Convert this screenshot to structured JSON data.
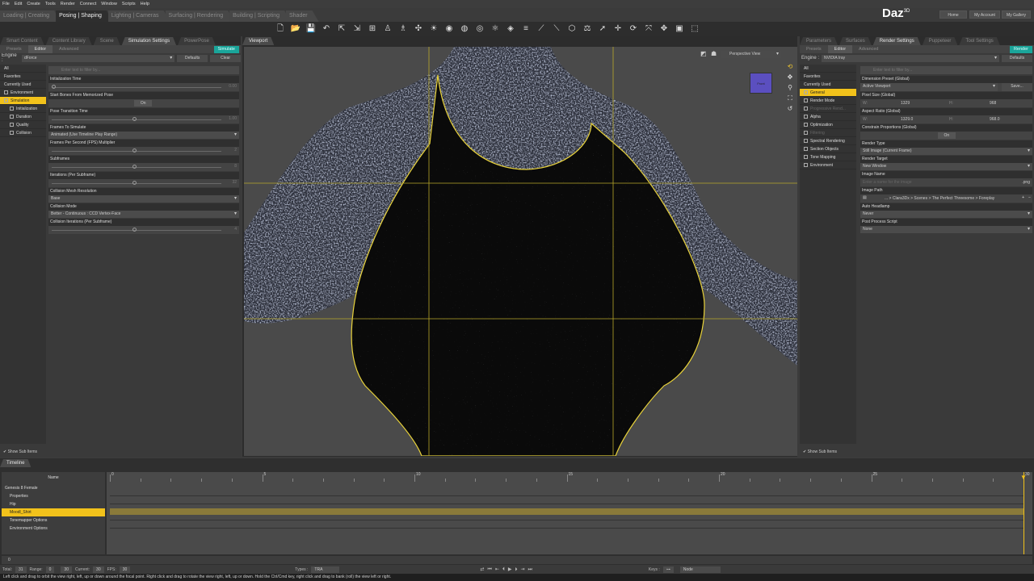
{
  "menu": [
    "File",
    "Edit",
    "Create",
    "Tools",
    "Render",
    "Connect",
    "Window",
    "Scripts",
    "Help"
  ],
  "layout_tabs": [
    {
      "label": "Loading | Creating",
      "active": false
    },
    {
      "label": "Posing | Shaping",
      "active": true
    },
    {
      "label": "Lighting | Cameras",
      "active": false
    },
    {
      "label": "Surfacing | Rendering",
      "active": false
    },
    {
      "label": "Building | Scripting",
      "active": false
    },
    {
      "label": "Shader",
      "active": false
    }
  ],
  "brand": {
    "name": "Daz",
    "sup": "3D"
  },
  "top_buttons": [
    "Home",
    "My Account",
    "My Gallery"
  ],
  "toolbar_icons": [
    "new-file-icon",
    "open-folder-icon",
    "save-icon",
    "undo-icon",
    "export-icon",
    "import-icon",
    "merge-icon",
    "figure-icon",
    "pose-icon",
    "universal-icon",
    "light-bulb-icon",
    "spot-icon",
    "render-icon",
    "iray-icon",
    "node-icon",
    "surface-icon",
    "align-icon",
    "joint-icon",
    "bone-icon",
    "geometry-icon",
    "weight-icon",
    "pointer-icon",
    "translate-icon",
    "rotate-icon",
    "scale-icon",
    "move-icon",
    "aux-viewport-icon",
    "frame-icon"
  ],
  "left_panel": {
    "tabs": [
      "Smart Content",
      "Content Library",
      "Scene",
      "Simulation Settings",
      "PowerPose"
    ],
    "active_tab": "Simulation Settings",
    "subtabs": [
      "Presets",
      "Editor",
      "Advanced"
    ],
    "action_button": "Simulate",
    "engine_label": "Engine :",
    "engine_value": "dForce",
    "defaults": "Defaults",
    "clear": "Clear",
    "categories": [
      "All",
      "Favorites",
      "Currently Used",
      "Environment",
      "Simulation",
      "Initialization",
      "Duration",
      "Quality",
      "Collision"
    ],
    "filter_placeholder": "Enter text to filter by...",
    "properties": [
      {
        "label": "Initialization Time",
        "type": "slider",
        "value": "0.00",
        "slider_pos": 0.0
      },
      {
        "label": "Start Bones From Memorized Pose",
        "type": "toggle",
        "value": "On"
      },
      {
        "label": "Pose Transition Time",
        "type": "slider",
        "value": "1.00",
        "slider_pos": 0.5
      },
      {
        "label": "Frames To Simulate",
        "type": "select",
        "value": "Animated (Use Timeline Play Range)"
      },
      {
        "label": "Frames Per Second (FPS) Multiplier",
        "type": "slider",
        "value": "2",
        "slider_pos": 0.5
      },
      {
        "label": "Subframes",
        "type": "slider",
        "value": "8",
        "slider_pos": 0.5
      },
      {
        "label": "Iterations (Per Subframe)",
        "type": "slider",
        "value": "32",
        "slider_pos": 0.5
      },
      {
        "label": "Collision Mesh Resolution",
        "type": "select",
        "value": "Base"
      },
      {
        "label": "Collision Mode",
        "type": "select",
        "value": "Better - Continuous : CCD Vertex-Face"
      },
      {
        "label": "Collision Iterations (Per Subframe)",
        "type": "slider",
        "value": "4",
        "slider_pos": 0.5
      }
    ],
    "show_sub_items": "Show Sub Items"
  },
  "viewport": {
    "tab": "Viewport",
    "view": "Perspective View",
    "cube_label": "Front"
  },
  "right_panel": {
    "tabs": [
      "Parameters",
      "Surfaces",
      "Render Settings",
      "Puppeteer",
      "Tool Settings"
    ],
    "active_tab": "Render Settings",
    "subtabs": [
      "Presets",
      "Editor",
      "Advanced"
    ],
    "action_button": "Render",
    "engine_label": "Engine :",
    "engine_value": "NVIDIA Iray",
    "defaults": "Defaults",
    "categories": [
      "All",
      "Favorites",
      "Currently Used",
      "General",
      "Render Mode",
      "Progressive Rend...",
      "Alpha",
      "Optimization",
      "Filtering",
      "Spectral Rendering",
      "Section Objects",
      "Tone Mapping",
      "Environment"
    ],
    "filter_placeholder": "Enter text to filter by...",
    "dimension_preset": {
      "label": "Dimension Preset (Global)",
      "value": "Active Viewport",
      "save": "Save..."
    },
    "pixel_size": {
      "label": "Pixel Size (Global)",
      "w": "1329",
      "h": "968"
    },
    "aspect_ratio": {
      "label": "Aspect Ratio (Global)",
      "w": "1329.0",
      "h": "968.0"
    },
    "constrain": {
      "label": "Constrain Proportions (Global)",
      "value": "On"
    },
    "render_type": {
      "label": "Render Type",
      "value": "Still Image (Current Frame)"
    },
    "render_target": {
      "label": "Render Target",
      "value": "New Window"
    },
    "image_name": {
      "label": "Image Name",
      "placeholder": "Enter a name for the image",
      "ext": ".png"
    },
    "image_path": {
      "label": "Image Path",
      "value": "... > Clara3Dx > Scenes > The Perfect Threesome > Foreplay"
    },
    "auto_headlamp": {
      "label": "Auto Headlamp",
      "value": "Never"
    },
    "post_process": {
      "label": "Post Process Script",
      "value": "None"
    },
    "show_sub_items": "Show Sub Items"
  },
  "timeline": {
    "tab": "Timeline",
    "name_header": "Name",
    "rows": [
      {
        "label": "Genesis 8 Female",
        "indent": 0,
        "selected": false
      },
      {
        "label": "Properties",
        "indent": 1,
        "selected": false
      },
      {
        "label": "Hip",
        "indent": 1,
        "selected": false
      },
      {
        "label": "Moodl_Shirt",
        "indent": 1,
        "selected": true
      },
      {
        "label": "Tonemapper Options",
        "indent": 1,
        "selected": false
      },
      {
        "label": "Environment Options",
        "indent": 1,
        "selected": false
      }
    ],
    "ticks": [
      "0",
      "5",
      "10",
      "15",
      "20",
      "25",
      "30"
    ],
    "frame_start": 0,
    "frame_end": 30,
    "current_frame": 30,
    "scrub_value": "0"
  },
  "bottom": {
    "total_label": "Total:",
    "total": "31",
    "range_label": "Range:",
    "range_start": "0",
    "range_end": "30",
    "current_label": "Current:",
    "current": "30",
    "fps_label": "FPS:",
    "fps": "30",
    "types_label": "Types :",
    "types": "TRA",
    "keys_label": "Keys :",
    "keys_mode": "Node"
  },
  "status": "Left click and drag to orbit the view right, left, up or down around the focal point. Right click and drag to rotate the view right, left, up or down. Hold the Ctrl/Cmd key, right click and drag to bank (roll) the view left or right.",
  "colors": {
    "accent": "#f2c21b",
    "action": "#1aa59a",
    "selection_outline": "#e8d23a"
  }
}
